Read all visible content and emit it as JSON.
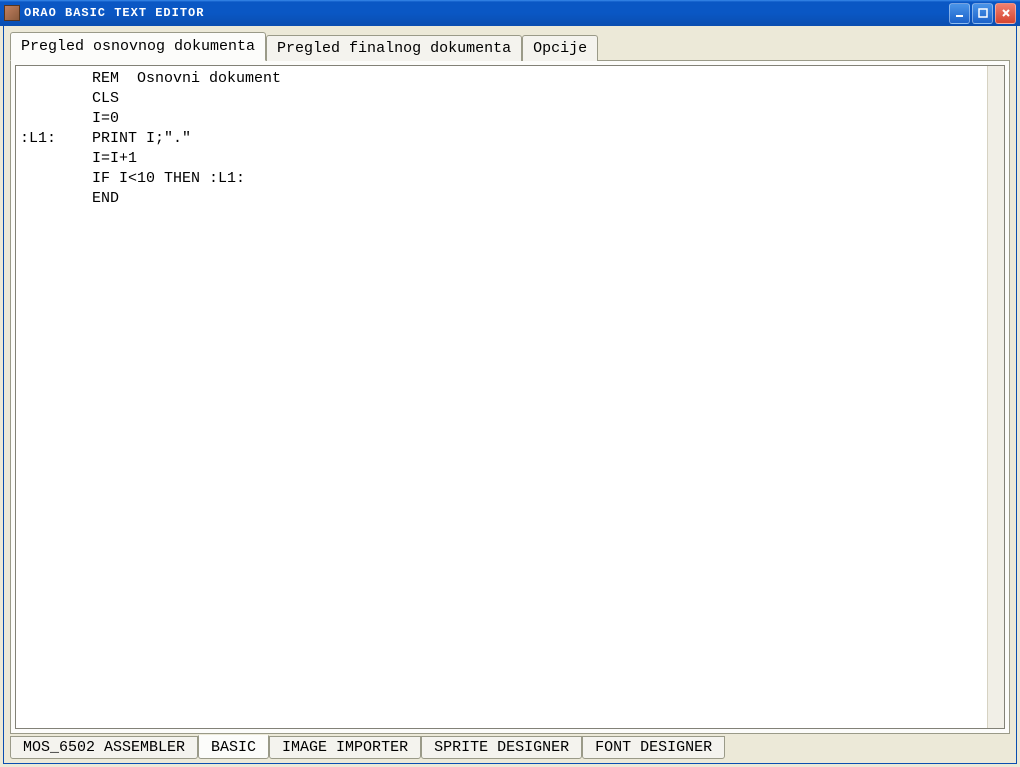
{
  "window": {
    "title": "ORAO  BASIC  TEXT  EDITOR"
  },
  "tabs": {
    "upper": [
      {
        "label": "Pregled osnovnog dokumenta",
        "active": true
      },
      {
        "label": "Pregled finalnog dokumenta",
        "active": false
      },
      {
        "label": "Opcije",
        "active": false
      }
    ],
    "lower": [
      {
        "label": "MOS_6502 ASSEMBLER",
        "active": false
      },
      {
        "label": "BASIC",
        "active": true
      },
      {
        "label": "IMAGE IMPORTER",
        "active": false
      },
      {
        "label": "SPRITE DESIGNER",
        "active": false
      },
      {
        "label": "FONT DESIGNER",
        "active": false
      }
    ]
  },
  "editor": {
    "content": "        REM  Osnovni dokument\n        CLS\n        I=0\n:L1:    PRINT I;\".\"\n        I=I+1\n        IF I<10 THEN :L1:\n        END"
  }
}
